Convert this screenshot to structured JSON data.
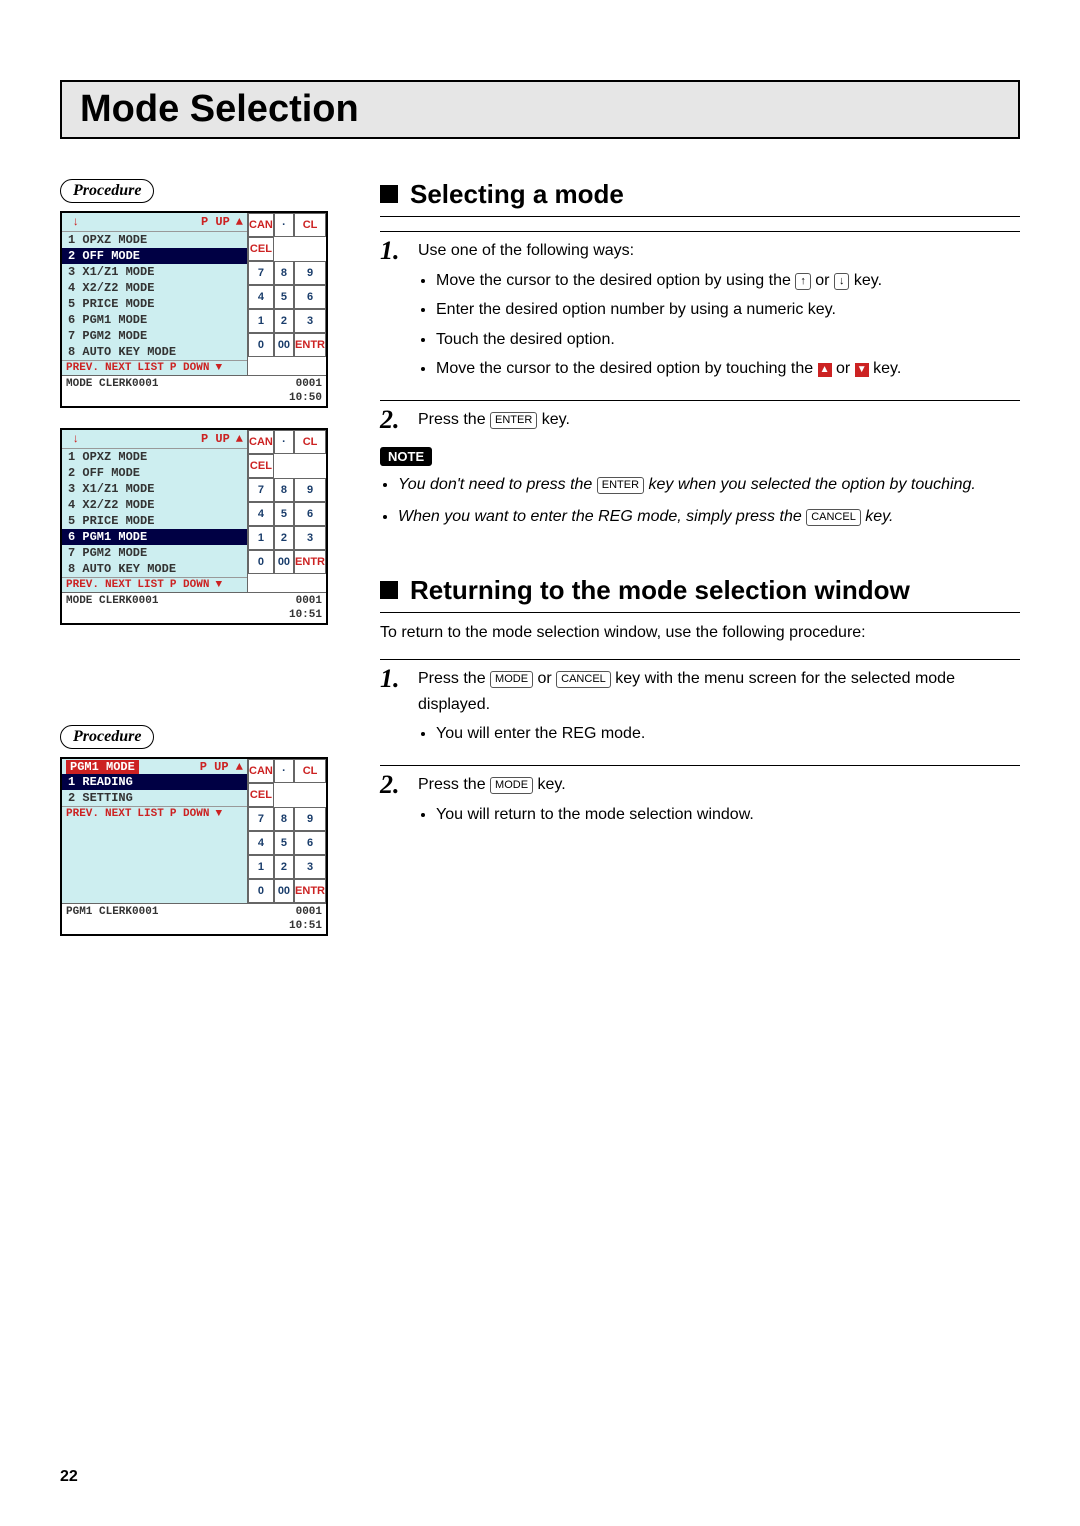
{
  "page_title": "Mode Selection",
  "page_number": "22",
  "procedure_label": "Procedure",
  "note_label": "NOTE",
  "keys": {
    "up": "↑",
    "down": "↓",
    "enter": "ENTER",
    "mode": "MODE",
    "cancel": "CANCEL",
    "tri_up": "▲",
    "tri_down": "▼"
  },
  "screens": [
    {
      "header": {
        "down": "↓",
        "pup": "P UP",
        "up": "▲"
      },
      "rows": [
        {
          "text": "1 OPXZ MODE"
        },
        {
          "text": "2 OFF MODE",
          "sel": true
        },
        {
          "text": "3 X1/Z1 MODE"
        },
        {
          "text": "4 X2/Z2 MODE"
        },
        {
          "text": "5 PRICE MODE"
        },
        {
          "text": "6 PGM1 MODE"
        },
        {
          "text": "7 PGM2 MODE"
        },
        {
          "text": "8 AUTO KEY MODE"
        }
      ],
      "bottom": [
        "PREV.",
        "NEXT",
        "LIST",
        "P DOWN",
        "▼"
      ],
      "status_left": "MODE   CLERK0001",
      "status_right": "0001",
      "time": "10:50"
    },
    {
      "header": {
        "down": "↓",
        "pup": "P UP",
        "up": "▲"
      },
      "rows": [
        {
          "text": "1 OPXZ MODE"
        },
        {
          "text": "2 OFF MODE"
        },
        {
          "text": "3 X1/Z1 MODE"
        },
        {
          "text": "4 X2/Z2 MODE"
        },
        {
          "text": "5 PRICE MODE"
        },
        {
          "text": "6 PGM1 MODE",
          "sel": true
        },
        {
          "text": "7 PGM2 MODE"
        },
        {
          "text": "8 AUTO KEY MODE"
        }
      ],
      "bottom": [
        "PREV.",
        "NEXT",
        "LIST",
        "P DOWN",
        "▼"
      ],
      "status_left": "MODE   CLERK0001",
      "status_right": "0001",
      "time": "10:51"
    },
    {
      "title": "PGM1 MODE",
      "header": {
        "down": "",
        "pup": "P UP",
        "up": "▲"
      },
      "rows": [
        {
          "text": "1 READING",
          "sel": true
        },
        {
          "text": "2 SETTING"
        }
      ],
      "bottom": [
        "PREV.",
        "NEXT",
        "LIST",
        "P DOWN",
        "▼"
      ],
      "status_left": "PGM1   CLERK0001",
      "status_right": "0001",
      "time": "10:51"
    }
  ],
  "keypad": [
    [
      "CAN",
      "·",
      "CL"
    ],
    [
      "CEL",
      "",
      ""
    ],
    [
      "7",
      "8",
      "9"
    ],
    [
      "4",
      "5",
      "6"
    ],
    [
      "1",
      "2",
      "3"
    ],
    [
      "0",
      "00",
      "ENTR"
    ]
  ],
  "section1": {
    "title": "Selecting a mode",
    "step1_intro": "Use one of the following ways:",
    "step1_b1a": "Move the cursor to the desired option by using the ",
    "step1_b1b": " or ",
    "step1_b1c": " key.",
    "step1_b2": "Enter the desired option number by using a numeric key.",
    "step1_b3": "Touch the desired option.",
    "step1_b4a": "Move the cursor to the desired option by touching the ",
    "step1_b4b": " or ",
    "step1_b4c": " key.",
    "step2a": "Press the ",
    "step2b": " key.",
    "note1a": "You don't need to press the ",
    "note1b": " key when you selected the option by touching.",
    "note2a": "When you want to enter the REG mode, simply press the ",
    "note2b": " key."
  },
  "section2": {
    "title": "Returning to the mode selection window",
    "intro": "To return to the mode selection window, use the following procedure:",
    "step1a": "Press the ",
    "step1b": " or ",
    "step1c": " key with the menu screen for the selected mode displayed.",
    "step1_bullet": "You will enter the REG mode.",
    "step2a": "Press the ",
    "step2b": " key.",
    "step2_bullet": "You will return to the mode selection window."
  }
}
